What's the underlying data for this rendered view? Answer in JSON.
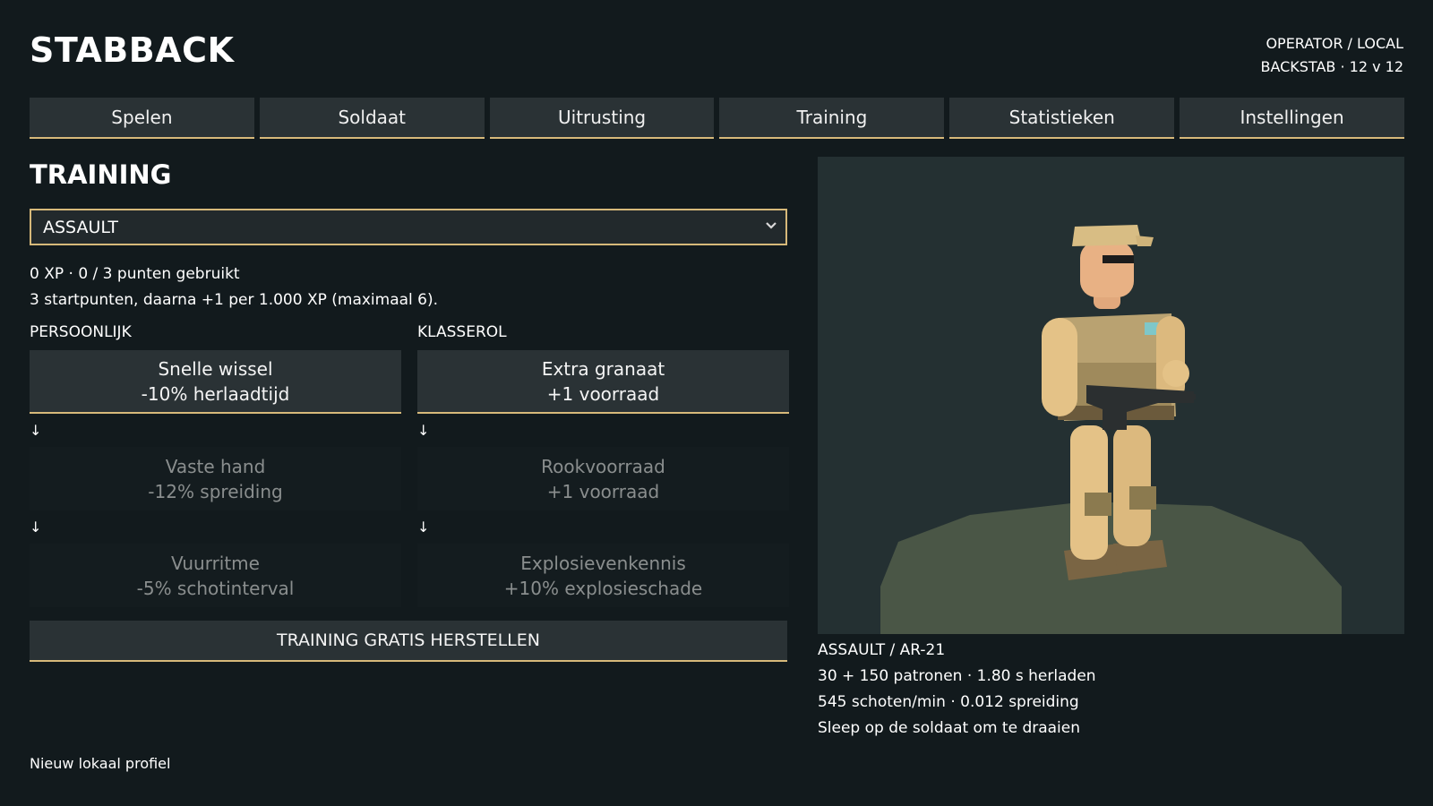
{
  "app": {
    "title": "STABBACK",
    "operator_line1": "OPERATOR / LOCAL",
    "operator_line2": "BACKSTAB · 12 v 12"
  },
  "nav": {
    "tabs": [
      {
        "label": "Spelen"
      },
      {
        "label": "Soldaat"
      },
      {
        "label": "Uitrusting"
      },
      {
        "label": "Training"
      },
      {
        "label": "Statistieken"
      },
      {
        "label": "Instellingen"
      }
    ]
  },
  "training": {
    "heading": "TRAINING",
    "class_select": {
      "value": "ASSAULT"
    },
    "xp_line": "0 XP · 0 / 3 punten gebruikt",
    "points_line": "3 startpunten, daarna +1 per 1.000 XP (maximaal 6).",
    "columns": [
      {
        "label": "PERSOONLIJK",
        "perks": [
          {
            "name": "Snelle wissel",
            "effect": "-10% herlaadtijd"
          },
          {
            "name": "Vaste hand",
            "effect": "-12% spreiding"
          },
          {
            "name": "Vuurritme",
            "effect": "-5% schotinterval"
          }
        ]
      },
      {
        "label": "KLASSEROL",
        "perks": [
          {
            "name": "Extra granaat",
            "effect": "+1 voorraad"
          },
          {
            "name": "Rookvoorraad",
            "effect": "+1 voorraad"
          },
          {
            "name": "Explosievenkennis",
            "effect": "+10% explosieschade"
          }
        ]
      }
    ],
    "arrow_glyph": "↓",
    "reset_label": "TRAINING GRATIS HERSTELLEN"
  },
  "preview": {
    "loadout": "ASSAULT / AR-21",
    "ammo_line": "30 + 150 patronen · 1.80 s herladen",
    "fire_line": "545 schoten/min · 0.012 spreiding",
    "hint": "Sleep op de soldaat om te draaien"
  },
  "footer": {
    "profile": "Nieuw lokaal profiel"
  },
  "colors": {
    "background": "#121a1d",
    "panel": "#2a3235",
    "accent": "#d7b97a",
    "locked_text": "#8a8e8e",
    "soldier_tan": "#e6c48a",
    "ground": "#4a5646"
  }
}
